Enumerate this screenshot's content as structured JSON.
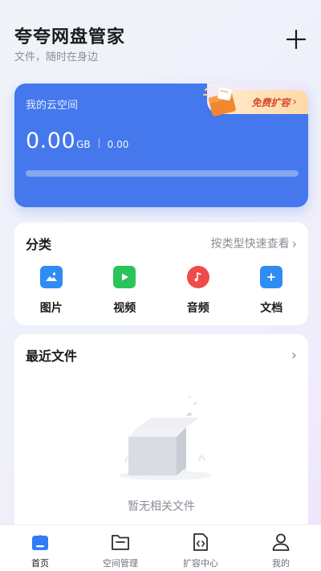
{
  "header": {
    "title": "夸夸网盘管家",
    "subtitle": "文件，随时在身边",
    "add_icon": "plus-icon"
  },
  "storage": {
    "label": "我的云空间",
    "used_value": "0.00",
    "used_unit": "GB",
    "total": "0.00",
    "usage_fraction": 0,
    "promo_label": "免费扩容",
    "promo_icon": "gift-box-icon",
    "card_color": "#4478ec"
  },
  "categories": {
    "title": "分类",
    "link_label": "按类型快速查看",
    "items": [
      {
        "label": "图片",
        "icon": "image-icon",
        "color": "#2f8cf2"
      },
      {
        "label": "视频",
        "icon": "video-icon",
        "color": "#2bc45a"
      },
      {
        "label": "音频",
        "icon": "music-icon",
        "color": "#f04a4a"
      },
      {
        "label": "文档",
        "icon": "document-plus-icon",
        "color": "#2f8cf2"
      }
    ]
  },
  "recent": {
    "title": "最近文件",
    "empty_text": "暂无相关文件",
    "empty_icon": "empty-box-icon"
  },
  "bottom_nav": {
    "items": [
      {
        "label": "首页",
        "icon": "home-icon",
        "active": true
      },
      {
        "label": "空间管理",
        "icon": "folder-icon",
        "active": false
      },
      {
        "label": "扩容中心",
        "icon": "code-file-icon",
        "active": false
      },
      {
        "label": "我的",
        "icon": "user-icon",
        "active": false
      }
    ],
    "active_color": "#2f7cf6"
  }
}
